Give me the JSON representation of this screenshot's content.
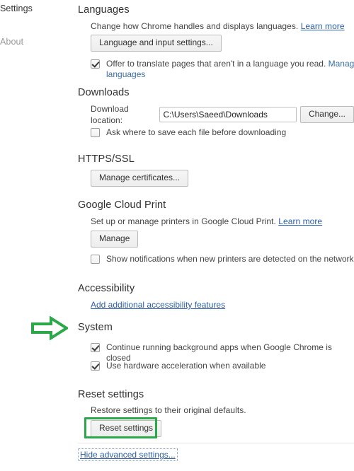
{
  "sidebar": {
    "items": [
      {
        "label": "Settings",
        "state": "active"
      },
      {
        "label": "About",
        "state": "normal"
      }
    ]
  },
  "sections": {
    "languages": {
      "title": "Languages",
      "description": "Change how Chrome handles and displays languages.",
      "learn_more": "Learn more",
      "button": "Language and input settings...",
      "checkbox": {
        "label": "Offer to translate pages that aren't in a language you read.",
        "checked": true,
        "link": "Manage languages"
      }
    },
    "downloads": {
      "title": "Downloads",
      "location_label": "Download location:",
      "location_value": "C:\\Users\\Saeed\\Downloads",
      "change_button": "Change...",
      "checkbox": {
        "label": "Ask where to save each file before downloading",
        "checked": false
      }
    },
    "https_ssl": {
      "title": "HTTPS/SSL",
      "button": "Manage certificates..."
    },
    "cloud_print": {
      "title": "Google Cloud Print",
      "description": "Set up or manage printers in Google Cloud Print.",
      "learn_more": "Learn more",
      "button": "Manage",
      "checkbox": {
        "label": "Show notifications when new printers are detected on the network",
        "checked": false
      }
    },
    "accessibility": {
      "title": "Accessibility",
      "link": "Add additional accessibility features"
    },
    "system": {
      "title": "System",
      "checkboxes": [
        {
          "label": "Continue running background apps when Google Chrome is closed",
          "checked": true
        },
        {
          "label": "Use hardware acceleration when available",
          "checked": true
        }
      ]
    },
    "reset": {
      "title": "Reset settings",
      "description": "Restore settings to their original defaults.",
      "button": "Reset settings"
    }
  },
  "footer": {
    "hide_advanced": "Hide advanced settings..."
  },
  "annotations": {
    "arrow_color": "#2aa84a",
    "highlight_color": "#2aa84a",
    "arrow_target": "System",
    "highlight_target": "Reset settings"
  }
}
